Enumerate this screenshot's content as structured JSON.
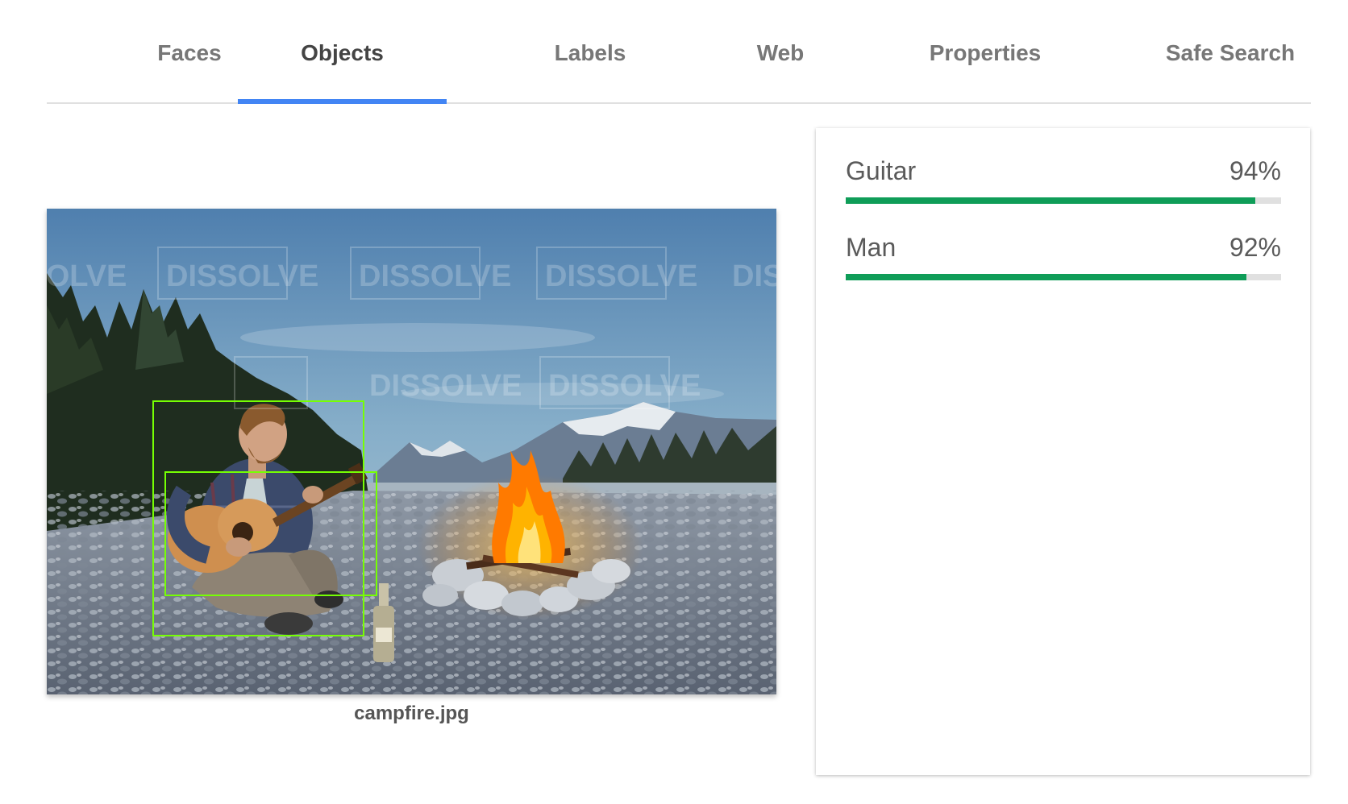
{
  "tabs": [
    {
      "label": "Faces"
    },
    {
      "label": "Objects"
    },
    {
      "label": "Labels"
    },
    {
      "label": "Web"
    },
    {
      "label": "Properties"
    },
    {
      "label": "Safe Search"
    }
  ],
  "active_tab": "Objects",
  "colors": {
    "tab_indicator": "#4285f4",
    "bar_fill": "#0f9d58",
    "bar_track": "#e0e0e0",
    "bounding_box": "#76ff03"
  },
  "image": {
    "filename": "campfire.jpg",
    "watermark": "DISSOLVE"
  },
  "results": [
    {
      "name": "Guitar",
      "score_label": "94%",
      "score": 0.94
    },
    {
      "name": "Man",
      "score_label": "92%",
      "score": 0.92
    }
  ]
}
